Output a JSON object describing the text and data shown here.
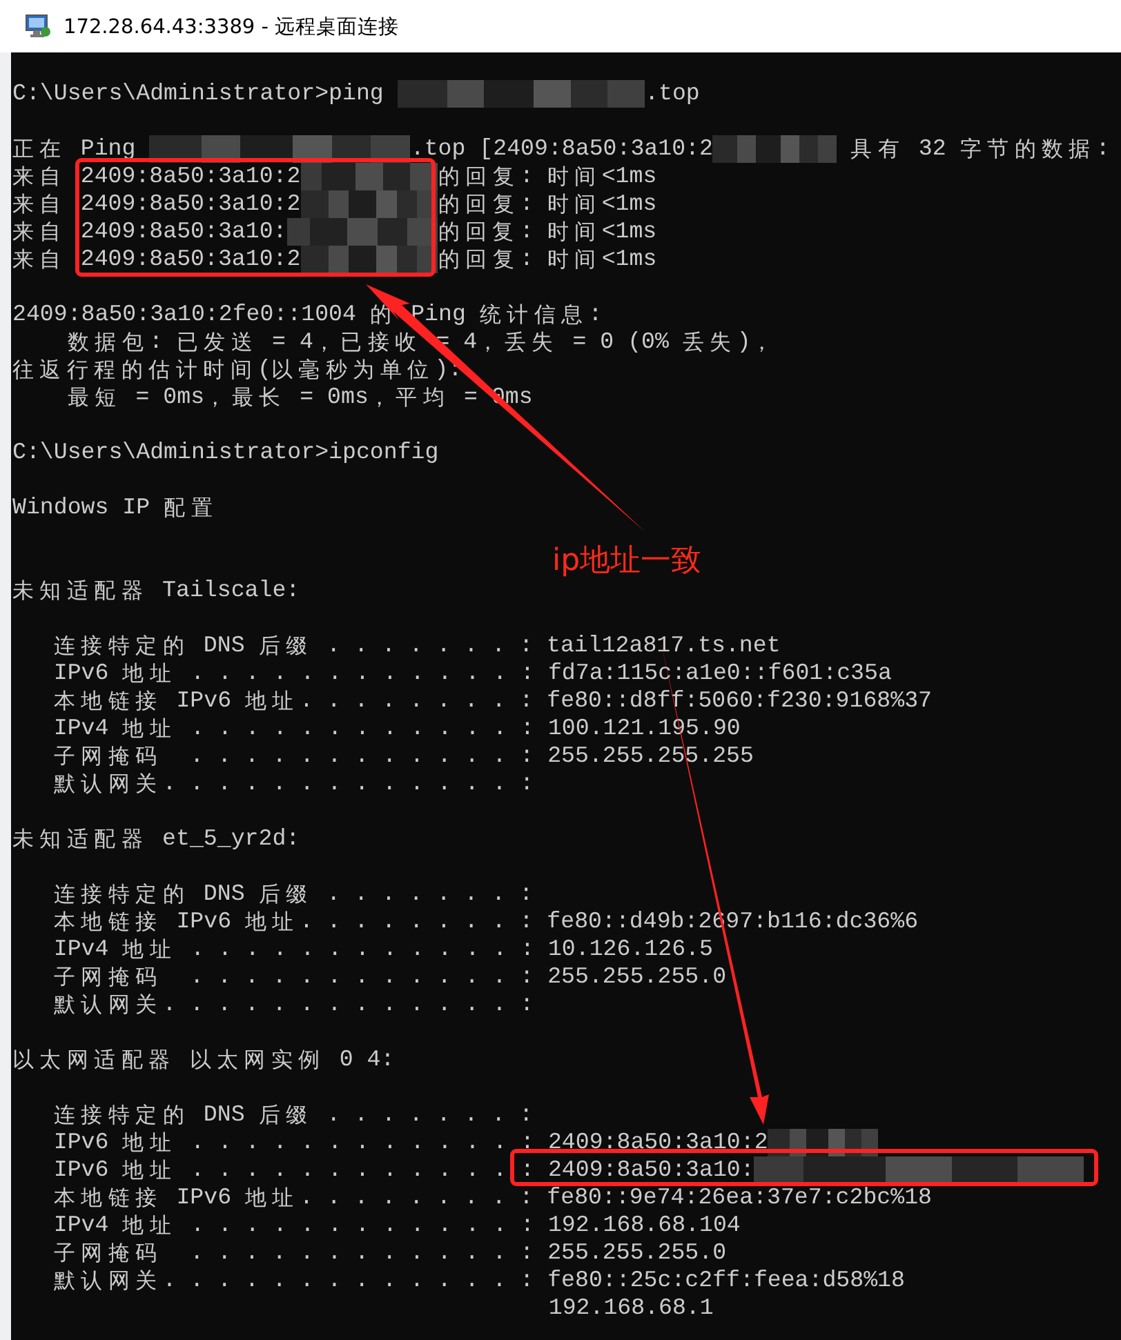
{
  "window": {
    "title": "172.28.64.43:3389 - 远程桌面连接"
  },
  "console": {
    "lines": [
      {
        "kind": "blank"
      },
      {
        "kind": "mixed",
        "parts": [
          {
            "text": "C:\\Users\\Administrator>ping "
          },
          {
            "kind": "blur"
          },
          {
            "text": ".top"
          }
        ]
      },
      {
        "kind": "blank"
      },
      {
        "kind": "mixed",
        "parts": [
          {
            "text": "正在 Ping "
          },
          {
            "kind": "blur"
          },
          {
            "text": ".top [2409:8a50:3a10:2"
          },
          {
            "kind": "blur"
          },
          {
            "text": " 具有 32 字节的数据:"
          }
        ]
      },
      {
        "kind": "mixed",
        "parts": [
          {
            "text": "来自 2409:8a50:3a10:2"
          },
          {
            "kind": "blur"
          },
          {
            "text": "的回复: 时间<1ms"
          }
        ]
      },
      {
        "kind": "mixed",
        "parts": [
          {
            "text": "来自 2409:8a50:3a10:2"
          },
          {
            "kind": "blur"
          },
          {
            "text": "的回复: 时间<1ms"
          }
        ]
      },
      {
        "kind": "mixed",
        "parts": [
          {
            "text": "来自 2409:8a50:3a10:"
          },
          {
            "kind": "blur"
          },
          {
            "text": "的回复: 时间<1ms"
          }
        ]
      },
      {
        "kind": "mixed",
        "parts": [
          {
            "text": "来自 2409:8a50:3a10:2"
          },
          {
            "kind": "blur"
          },
          {
            "text": "的回复: 时间<1ms"
          }
        ]
      },
      {
        "kind": "blank"
      },
      {
        "kind": "text",
        "text": "2409:8a50:3a10:2fe0::1004 的 Ping 统计信息:"
      },
      {
        "kind": "text",
        "text": "    数据包: 已发送 = 4，已接收 = 4，丢失 = 0 (0% 丢失)，"
      },
      {
        "kind": "text",
        "text": "往返行程的估计时间(以毫秒为单位):"
      },
      {
        "kind": "text",
        "text": "    最短 = 0ms，最长 = 0ms，平均 = 0ms"
      },
      {
        "kind": "blank"
      },
      {
        "kind": "text",
        "text": "C:\\Users\\Administrator>ipconfig"
      },
      {
        "kind": "blank"
      },
      {
        "kind": "text",
        "text": "Windows IP 配置"
      },
      {
        "kind": "blank"
      },
      {
        "kind": "blank"
      },
      {
        "kind": "text",
        "text": "未知适配器 Tailscale:"
      },
      {
        "kind": "blank"
      },
      {
        "kind": "text",
        "text": "   连接特定的 DNS 后缀 . . . . . . . : tail12a817.ts.net"
      },
      {
        "kind": "text",
        "text": "   IPv6 地址 . . . . . . . . . . . . : fd7a:115c:a1e0::f601:c35a"
      },
      {
        "kind": "text",
        "text": "   本地链接 IPv6 地址. . . . . . . . : fe80::d8ff:5060:f230:9168%37"
      },
      {
        "kind": "text",
        "text": "   IPv4 地址 . . . . . . . . . . . . : 100.121.195.90"
      },
      {
        "kind": "text",
        "text": "   子网掩码  . . . . . . . . . . . . : 255.255.255.255"
      },
      {
        "kind": "text",
        "text": "   默认网关. . . . . . . . . . . . . :"
      },
      {
        "kind": "blank"
      },
      {
        "kind": "text",
        "text": "未知适配器 et_5_yr2d:"
      },
      {
        "kind": "blank"
      },
      {
        "kind": "text",
        "text": "   连接特定的 DNS 后缀 . . . . . . . :"
      },
      {
        "kind": "text",
        "text": "   本地链接 IPv6 地址. . . . . . . . : fe80::d49b:2697:b116:dc36%6"
      },
      {
        "kind": "text",
        "text": "   IPv4 地址 . . . . . . . . . . . . : 10.126.126.5"
      },
      {
        "kind": "text",
        "text": "   子网掩码  . . . . . . . . . . . . : 255.255.255.0"
      },
      {
        "kind": "text",
        "text": "   默认网关. . . . . . . . . . . . . :"
      },
      {
        "kind": "blank"
      },
      {
        "kind": "text",
        "text": "以太网适配器 以太网实例 0 4:"
      },
      {
        "kind": "blank"
      },
      {
        "kind": "text",
        "text": "   连接特定的 DNS 后缀 . . . . . . . :"
      },
      {
        "kind": "mixed",
        "parts": [
          {
            "text": "   IPv6 地址 . . . . . . . . . . . . : 2409:8a50:3a10:2"
          },
          {
            "kind": "blur"
          }
        ]
      },
      {
        "kind": "mixed",
        "parts": [
          {
            "text": "   IPv6 地址 . . . . . . . . . . . . : 2409:8a50:3a10:"
          },
          {
            "kind": "blur"
          }
        ]
      },
      {
        "kind": "text",
        "text": "   本地链接 IPv6 地址. . . . . . . . : fe80::9e74:26ea:37e7:c2bc%18"
      },
      {
        "kind": "text",
        "text": "   IPv4 地址 . . . . . . . . . . . . : 192.168.68.104"
      },
      {
        "kind": "text",
        "text": "   子网掩码  . . . . . . . . . . . . : 255.255.255.0"
      },
      {
        "kind": "text",
        "text": "   默认网关. . . . . . . . . . . . . : fe80::25c:c2ff:feea:d58%18"
      },
      {
        "kind": "text",
        "text": "                                       192.168.68.1"
      }
    ]
  },
  "annotation": {
    "label": "ip地址一致"
  }
}
